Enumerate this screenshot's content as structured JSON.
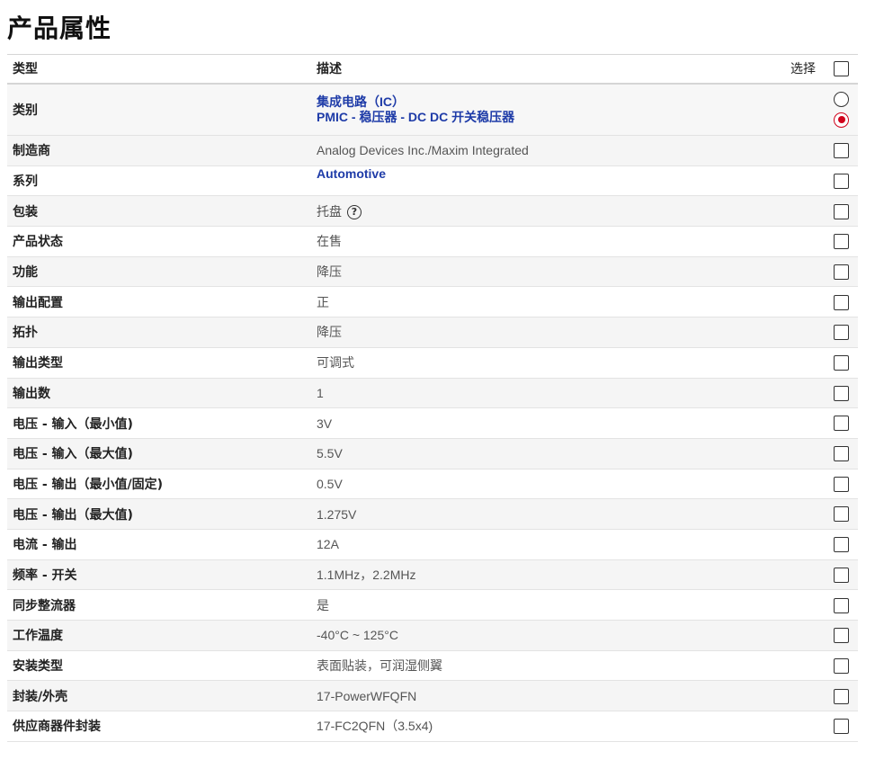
{
  "page_title": "产品属性",
  "headers": {
    "type": "类型",
    "desc": "描述",
    "select": "选择"
  },
  "category": {
    "label": "类别",
    "line1": "集成电路（IC）",
    "line2": "PMIC - 稳压器 - DC DC 开关稳压器"
  },
  "rows": [
    {
      "key": "制造商",
      "value": "Analog Devices Inc./Maxim Integrated"
    },
    {
      "key": "系列",
      "value": "Automotive"
    },
    {
      "key": "包装",
      "value": "托盘"
    },
    {
      "key": "产品状态",
      "value": "在售"
    },
    {
      "key": "功能",
      "value": "降压"
    },
    {
      "key": "输出配置",
      "value": "正"
    },
    {
      "key": "拓扑",
      "value": "降压"
    },
    {
      "key": "输出类型",
      "value": "可调式"
    },
    {
      "key": "输出数",
      "value": "1"
    },
    {
      "key": "电压 - 输入（最小值)",
      "value": "3V"
    },
    {
      "key": "电压 - 输入（最大值)",
      "value": "5.5V"
    },
    {
      "key": "电压 - 输出（最小值/固定)",
      "value": "0.5V"
    },
    {
      "key": "电压 - 输出（最大值)",
      "value": "1.275V"
    },
    {
      "key": "电流 - 输出",
      "value": "12A"
    },
    {
      "key": "频率 - 开关",
      "value": "1.1MHz，2.2MHz"
    },
    {
      "key": "同步整流器",
      "value": "是"
    },
    {
      "key": "工作温度",
      "value": "-40°C ~ 125°C"
    },
    {
      "key": "安装类型",
      "value": "表面贴装，可润湿侧翼"
    },
    {
      "key": "封装/外壳",
      "value": "17-PowerWFQFN"
    },
    {
      "key": "供应商器件封装",
      "value": "17-FC2QFN（3.5x4)"
    }
  ],
  "help_glyph": "?",
  "colors": {
    "link": "#1f3ca8",
    "radio_selected": "#d0021b"
  }
}
